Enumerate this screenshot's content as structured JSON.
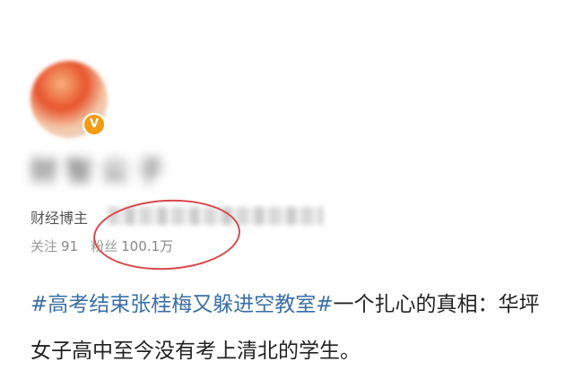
{
  "profile": {
    "verified_badge": "V",
    "username": "财 智 公 子",
    "blogger_label": "财经博主",
    "following_label": "关注",
    "following_count": "91",
    "followers_label": "粉丝",
    "followers_count": "100.1万"
  },
  "post": {
    "hashtag": "#高考结束张桂梅又躲进空教室#",
    "text_line1": "一个扎心的真相：华坪",
    "text_line2": "女子高中至今没有考上清北的学生。"
  },
  "colors": {
    "hashtag": "#3a6ea5",
    "annotation_circle": "#d9484b",
    "badge": "#f39c12"
  }
}
